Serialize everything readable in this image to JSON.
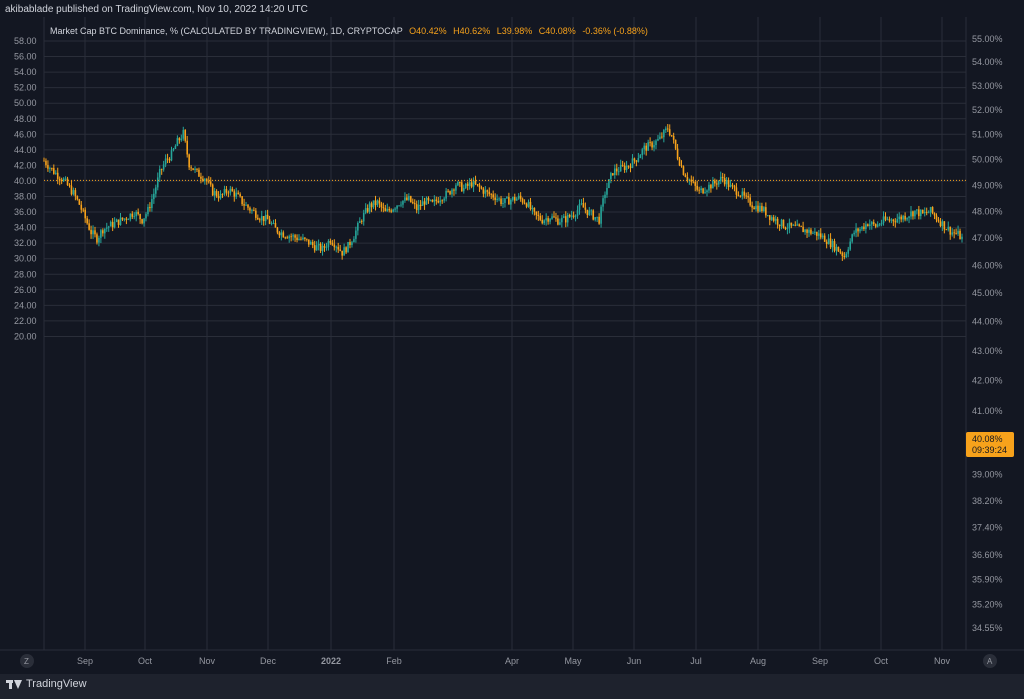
{
  "header": {
    "published_by": "akibablade published on TradingView.com, Nov 10, 2022 14:20 UTC"
  },
  "legend": {
    "title": "Market Cap BTC Dominance, % (CALCULATED BY TRADINGVIEW), 1D, CRYPTOCAP",
    "open": "O40.42%",
    "high": "H40.62%",
    "low": "L39.98%",
    "close": "C40.08%",
    "change": "-0.36% (-0.88%)"
  },
  "price_tag": {
    "value": "40.08%",
    "countdown": "09:39:24"
  },
  "footer": {
    "brand": "TradingView",
    "zoom_button": "Z",
    "auto_button": "A"
  },
  "colors": {
    "background": "#131722",
    "grid": "#2a2e39",
    "up": "#26a69a",
    "down": "#f7a21b",
    "text": "#9598a1",
    "price_tag": "#f7a21b"
  },
  "chart_data": {
    "type": "candlestick",
    "symbol": "Market Cap BTC Dominance, % (CALCULATED BY TRADINGVIEW), 1D, CRYPTOCAP",
    "last_close": 40.08,
    "left_axis": {
      "ticks": [
        "58.00",
        "56.00",
        "54.00",
        "52.00",
        "50.00",
        "48.00",
        "46.00",
        "44.00",
        "42.00",
        "40.00",
        "38.00",
        "36.00",
        "34.00",
        "32.00",
        "30.00",
        "28.00",
        "26.00",
        "24.00",
        "22.00",
        "20.00"
      ],
      "range": [
        20,
        58
      ]
    },
    "right_axis": {
      "ticks": [
        "55.00%",
        "54.00%",
        "53.00%",
        "52.00%",
        "51.00%",
        "50.00%",
        "49.00%",
        "48.00%",
        "47.00%",
        "46.00%",
        "45.00%",
        "44.00%",
        "43.00%",
        "42.00%",
        "41.00%",
        "40.00%",
        "39.00%",
        "38.20%",
        "37.40%",
        "36.60%",
        "35.90%",
        "35.20%",
        "34.55%"
      ],
      "scale": "logarithmic"
    },
    "x_axis": {
      "labels": [
        "Sep",
        "Oct",
        "Nov",
        "Dec",
        "2022",
        "Feb",
        "Apr",
        "May",
        "Jun",
        "Jul",
        "Aug",
        "Sep",
        "Oct",
        "Nov"
      ]
    },
    "path": [
      [
        0,
        42.6
      ],
      [
        5,
        41.2
      ],
      [
        10,
        40.1
      ],
      [
        15,
        38.4
      ],
      [
        18,
        37.0
      ],
      [
        21,
        35.2
      ],
      [
        24,
        33.4
      ],
      [
        27,
        32.6
      ],
      [
        30,
        33.8
      ],
      [
        34,
        34.3
      ],
      [
        38,
        34.8
      ],
      [
        42,
        35.3
      ],
      [
        46,
        36.0
      ],
      [
        50,
        35.0
      ],
      [
        53,
        36.2
      ],
      [
        56,
        38.4
      ],
      [
        59,
        41.0
      ],
      [
        62,
        42.6
      ],
      [
        65,
        43.4
      ],
      [
        68,
        45.0
      ],
      [
        71,
        46.1
      ],
      [
        74,
        42.2
      ],
      [
        78,
        41.0
      ],
      [
        82,
        40.4
      ],
      [
        86,
        38.6
      ],
      [
        90,
        38.0
      ],
      [
        94,
        38.9
      ],
      [
        98,
        38.2
      ],
      [
        102,
        37.0
      ],
      [
        106,
        36.2
      ],
      [
        110,
        35.4
      ],
      [
        114,
        35.0
      ],
      [
        118,
        33.8
      ],
      [
        122,
        33.2
      ],
      [
        126,
        32.9
      ],
      [
        130,
        32.6
      ],
      [
        134,
        32.2
      ],
      [
        138,
        31.6
      ],
      [
        142,
        31.2
      ],
      [
        146,
        32.5
      ],
      [
        149,
        31.8
      ],
      [
        152,
        30.8
      ],
      [
        155,
        31.6
      ],
      [
        158,
        33.0
      ],
      [
        162,
        35.2
      ],
      [
        166,
        36.8
      ],
      [
        170,
        37.2
      ],
      [
        174,
        35.9
      ],
      [
        178,
        36.6
      ],
      [
        182,
        37.4
      ],
      [
        186,
        37.6
      ],
      [
        190,
        36.4
      ],
      [
        194,
        37.4
      ],
      [
        198,
        37.0
      ],
      [
        202,
        37.9
      ],
      [
        206,
        38.4
      ],
      [
        210,
        39.6
      ],
      [
        214,
        39.0
      ],
      [
        218,
        39.7
      ],
      [
        222,
        39.1
      ],
      [
        226,
        38.4
      ],
      [
        230,
        38.0
      ],
      [
        234,
        37.2
      ],
      [
        238,
        37.6
      ],
      [
        242,
        37.8
      ],
      [
        246,
        37.2
      ],
      [
        250,
        35.6
      ],
      [
        254,
        35.0
      ],
      [
        258,
        35.4
      ],
      [
        262,
        34.9
      ],
      [
        266,
        35.1
      ],
      [
        270,
        35.8
      ],
      [
        274,
        36.8
      ],
      [
        277,
        36.1
      ],
      [
        280,
        35.5
      ],
      [
        283,
        35.0
      ],
      [
        286,
        38.5
      ],
      [
        290,
        41.2
      ],
      [
        294,
        41.6
      ],
      [
        298,
        42.0
      ],
      [
        302,
        42.9
      ],
      [
        306,
        44.2
      ],
      [
        310,
        44.7
      ],
      [
        314,
        45.4
      ],
      [
        318,
        46.8
      ],
      [
        320,
        45.8
      ],
      [
        323,
        43.2
      ],
      [
        326,
        41.2
      ],
      [
        330,
        39.8
      ],
      [
        334,
        38.6
      ],
      [
        338,
        39.2
      ],
      [
        342,
        39.7
      ],
      [
        346,
        40.4
      ],
      [
        350,
        39.2
      ],
      [
        354,
        38.6
      ],
      [
        358,
        37.6
      ],
      [
        362,
        36.8
      ],
      [
        366,
        36.4
      ],
      [
        370,
        35.5
      ],
      [
        374,
        34.8
      ],
      [
        378,
        34.2
      ],
      [
        382,
        34.0
      ],
      [
        386,
        33.8
      ],
      [
        390,
        33.5
      ],
      [
        394,
        33.2
      ],
      [
        398,
        32.6
      ],
      [
        402,
        31.8
      ],
      [
        406,
        30.9
      ],
      [
        408,
        30.3
      ],
      [
        410,
        31.6
      ],
      [
        413,
        33.4
      ],
      [
        416,
        33.8
      ],
      [
        420,
        34.6
      ],
      [
        424,
        34.2
      ],
      [
        428,
        34.9
      ],
      [
        432,
        35.0
      ],
      [
        436,
        35.2
      ],
      [
        440,
        35.6
      ],
      [
        444,
        36.1
      ],
      [
        448,
        35.7
      ],
      [
        452,
        36.1
      ],
      [
        456,
        35.0
      ],
      [
        460,
        34.0
      ],
      [
        463,
        33.4
      ],
      [
        466,
        33.1
      ],
      [
        468,
        32.6
      ]
    ]
  }
}
